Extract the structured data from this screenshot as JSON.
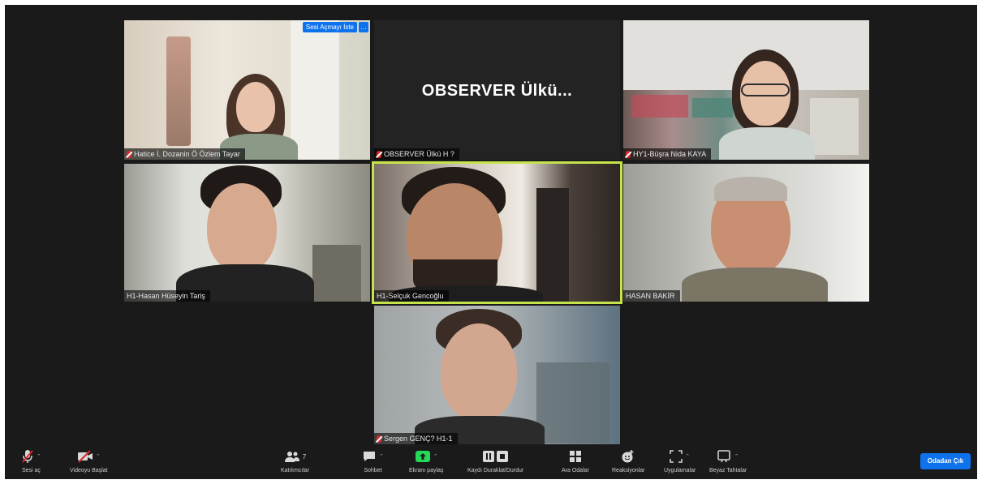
{
  "participants": [
    {
      "id": "p1",
      "name": "Hatice İ. Dozanin Ö Özlem Tayar",
      "spotlight_label": "Sesi Açmayı İste",
      "spotlight_more": "…"
    },
    {
      "id": "p2",
      "name": "OBSERVER Ülkü H ?",
      "display_text": "OBSERVER  Ülkü..."
    },
    {
      "id": "p3",
      "name": "HY1-Büşra Nida KAYA"
    },
    {
      "id": "p4",
      "name": "H1-Hasan Hüseyin Tariş"
    },
    {
      "id": "p5",
      "name": "H1-Selçuk Gencoğlu"
    },
    {
      "id": "p6",
      "name": "HASAN BAKİR"
    },
    {
      "id": "p7",
      "name": "Sergen GENÇ? H1-1"
    }
  ],
  "toolbar": {
    "audio_label": "Sesi aç",
    "video_label": "Videoyu Başlat",
    "participants_label": "Katılımcılar",
    "participants_count": "7",
    "chat_label": "Sohbet",
    "share_label": "Ekranı paylaş",
    "record_label": "Kaydı Duraklat/Durdur",
    "breakout_label": "Ara Odalar",
    "reactions_label": "Reaksiyonlar",
    "apps_label": "Uygulamalar",
    "whiteboard_label": "Beyaz Tahtalar",
    "leave_label": "Odadan Çık"
  },
  "colors": {
    "window_bg": "#1a1a1a",
    "active_speaker_border": "#c5e34a",
    "accent": "#0e72ed",
    "muted_red": "#e02828",
    "share_green": "#23d959"
  }
}
